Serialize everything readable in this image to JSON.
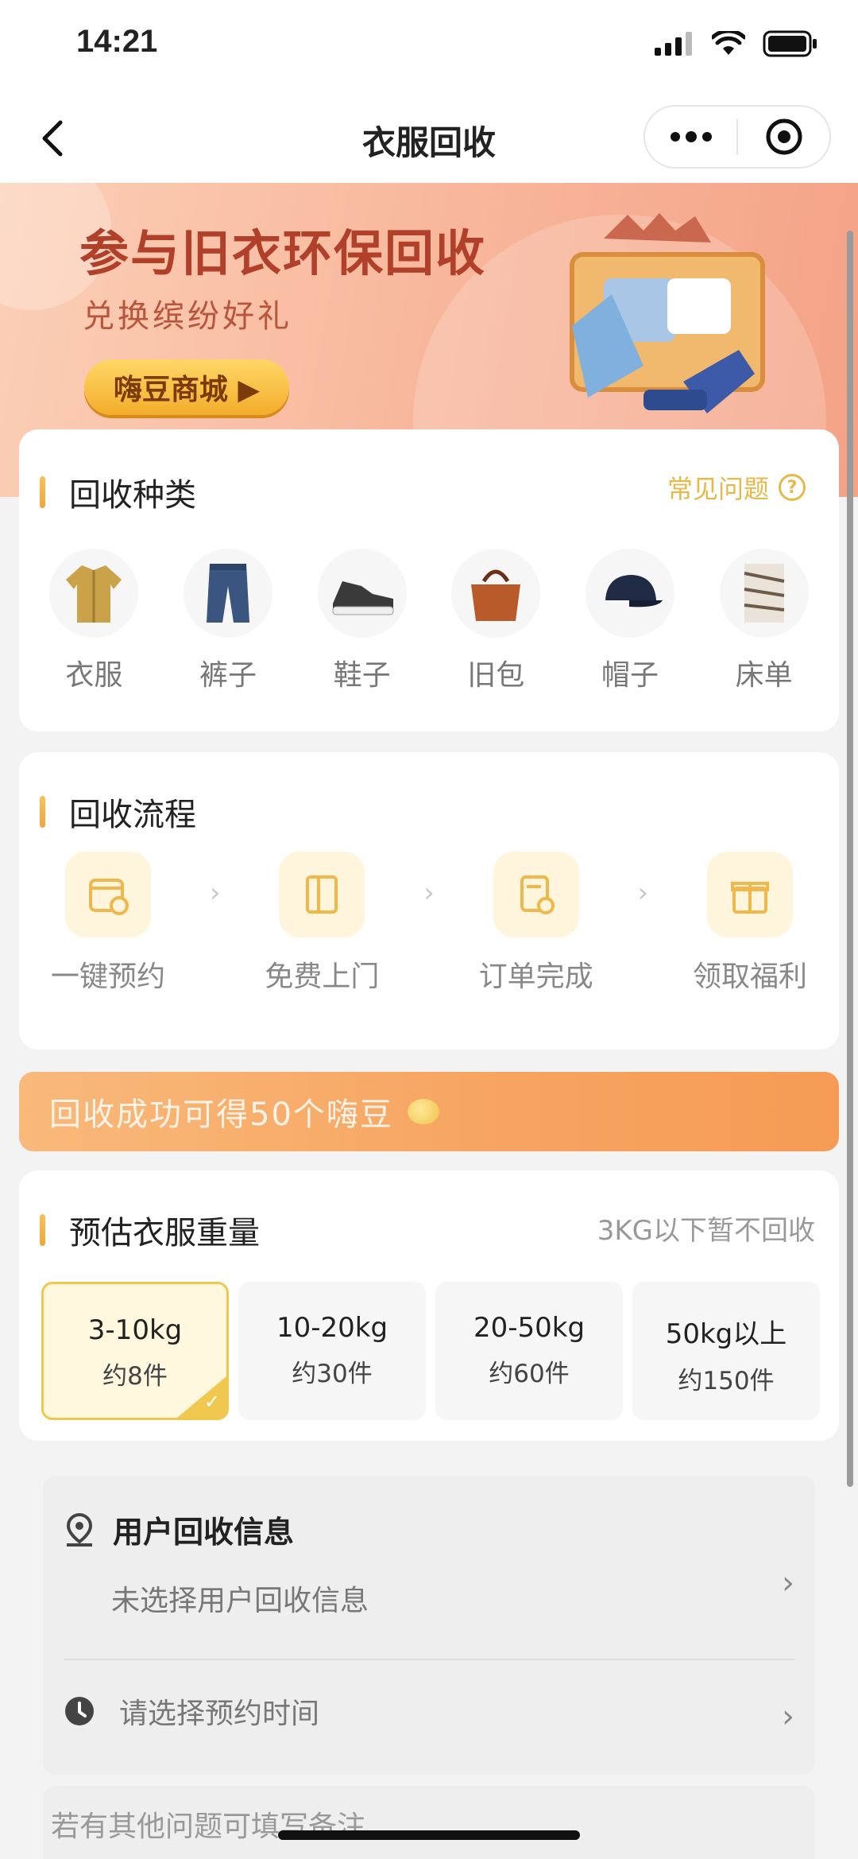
{
  "status_bar": {
    "time": "14:21",
    "icons": [
      "signal-icon",
      "wifi-icon",
      "battery-icon"
    ]
  },
  "nav": {
    "title": "衣服回收",
    "back_icon": "chevron-left-icon",
    "more_icon": "more-dots-icon",
    "close_icon": "target-circle-icon"
  },
  "banner": {
    "headline": "参与旧衣环保回收",
    "subline": "兑换缤纷好礼",
    "mall_button": "嗨豆商城 ▶"
  },
  "categories": {
    "title": "回收种类",
    "faq": "常见问题",
    "items": [
      {
        "label": "衣服",
        "icon": "shirt-icon"
      },
      {
        "label": "裤子",
        "icon": "jeans-icon"
      },
      {
        "label": "鞋子",
        "icon": "shoe-icon"
      },
      {
        "label": "旧包",
        "icon": "bag-icon"
      },
      {
        "label": "帽子",
        "icon": "cap-icon"
      },
      {
        "label": "床单",
        "icon": "sheet-icon"
      }
    ]
  },
  "process": {
    "title": "回收流程",
    "steps": [
      {
        "label": "一键预约",
        "icon": "calendar-icon"
      },
      {
        "label": "免费上门",
        "icon": "door-icon"
      },
      {
        "label": "订单完成",
        "icon": "checked-document-icon"
      },
      {
        "label": "领取福利",
        "icon": "gift-icon"
      }
    ]
  },
  "reward_banner": {
    "text": "回收成功可得50个嗨豆"
  },
  "weight": {
    "title": "预估衣服重量",
    "hint": "3KG以下暂不回收",
    "options": [
      {
        "range": "3-10kg",
        "pieces": "约8件",
        "selected": true
      },
      {
        "range": "10-20kg",
        "pieces": "约30件",
        "selected": false
      },
      {
        "range": "20-50kg",
        "pieces": "约60件",
        "selected": false
      },
      {
        "range": "50kg以上",
        "pieces": "约150件",
        "selected": false
      }
    ]
  },
  "user_info": {
    "title": "用户回收信息",
    "placeholder": "未选择用户回收信息",
    "time_placeholder": "请选择预约时间"
  },
  "note": {
    "placeholder": "若有其他问题可填写备注"
  },
  "colors": {
    "accent": "#f0c850",
    "banner_text": "#b0402a",
    "reward_bg": "#f7a460"
  }
}
